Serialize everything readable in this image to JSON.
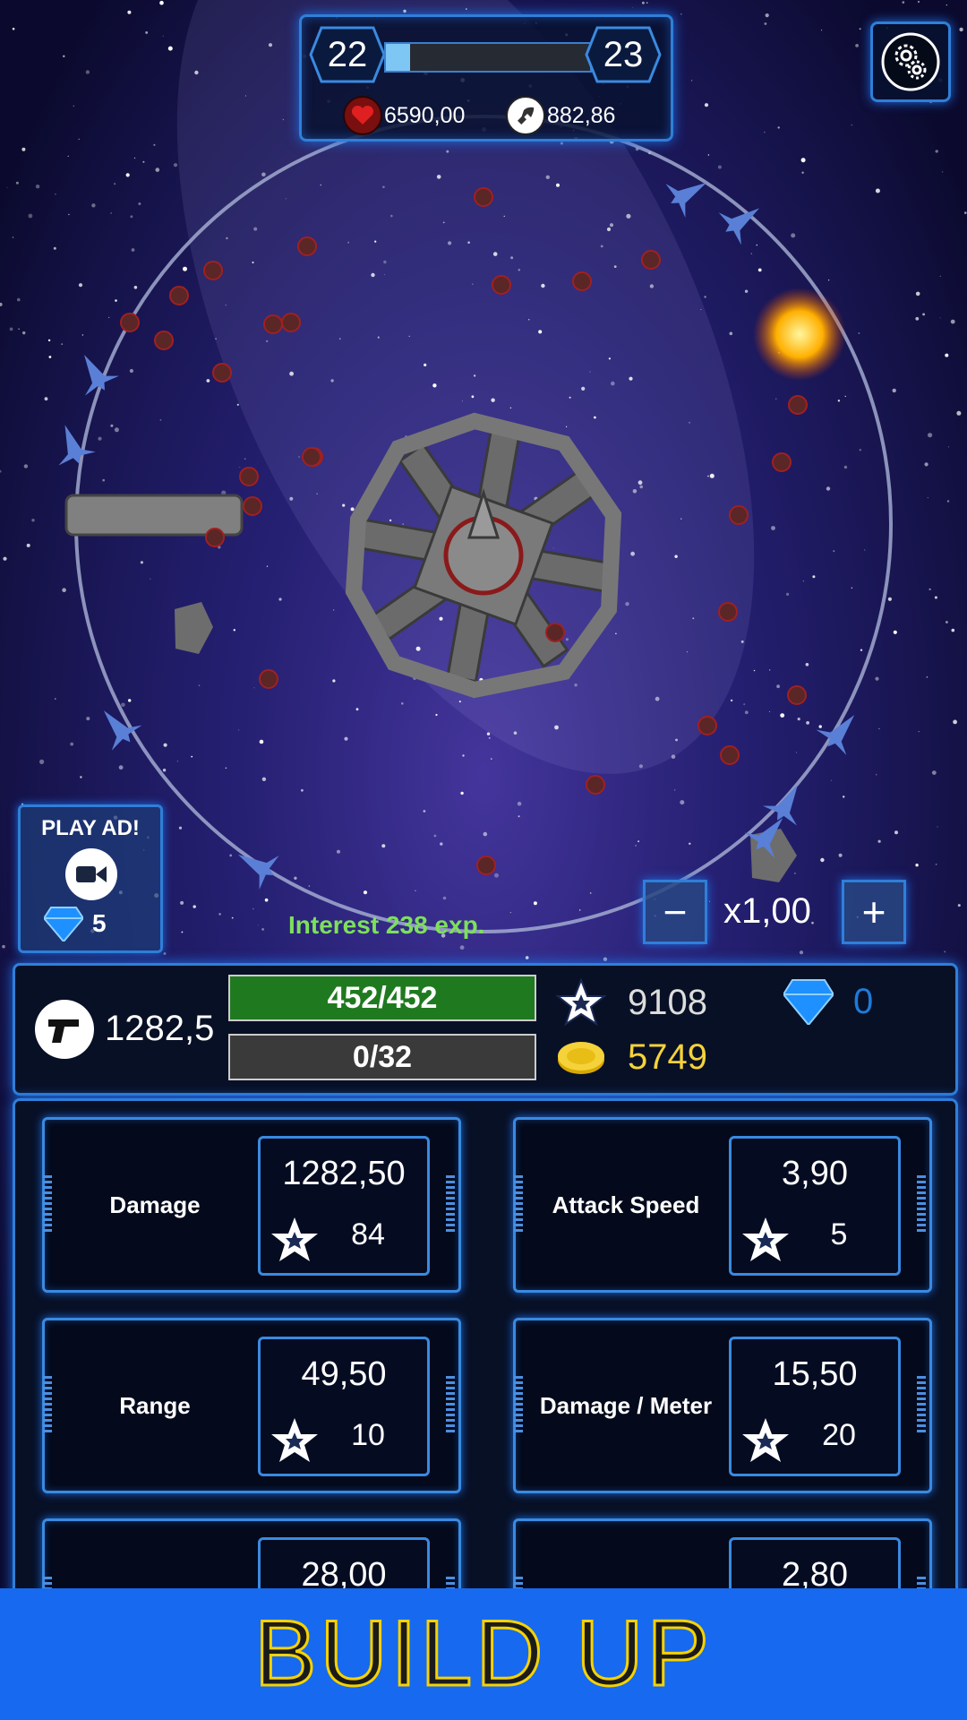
{
  "level": {
    "current": "22",
    "next": "23",
    "progress": 0.12,
    "health": "6590,00",
    "ammo": "882,86"
  },
  "ad": {
    "title": "PLAY AD!",
    "cost": "5"
  },
  "interest_text": "Interest 238 exp.",
  "speed": {
    "minus": "−",
    "value": "x1,00",
    "plus": "+"
  },
  "status": {
    "damage": "1282,5",
    "hp_bar": "452/452",
    "xp_bar": "0/32",
    "stars": "9108",
    "gems": "0",
    "coins": "5749"
  },
  "upgrades": [
    {
      "name": "Damage",
      "value": "1282,50",
      "cost": "84"
    },
    {
      "name": "Attack Speed",
      "value": "3,90",
      "cost": "5"
    },
    {
      "name": "Range",
      "value": "49,50",
      "cost": "10"
    },
    {
      "name": "Damage / Meter",
      "value": "15,50",
      "cost": "20"
    },
    {
      "name": "",
      "value": "28,00",
      "cost": ""
    },
    {
      "name": "",
      "value": "2,80",
      "cost": ""
    }
  ],
  "build_label": "BUILD UP",
  "colors": {
    "panel_border": "#2f7fd8",
    "hp_bar": "#1f7a1f",
    "xp_bar": "#3a3a3a",
    "coins_text": "#f5d23a",
    "gems_text": "#1e7bd8",
    "interest_text": "#7de05a",
    "build_bg": "#1769ef"
  }
}
